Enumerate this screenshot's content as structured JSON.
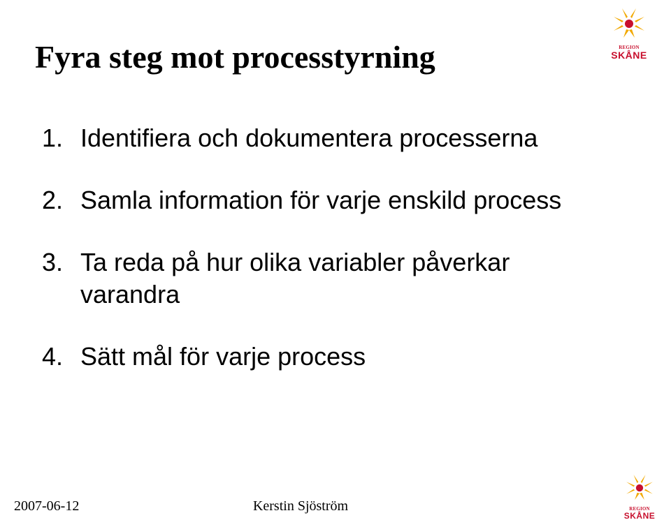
{
  "title": "Fyra steg mot processtyrning",
  "items": [
    {
      "num": "1.",
      "text": "Identifiera och dokumentera processerna"
    },
    {
      "num": "2.",
      "text": "Samla information för varje enskild process"
    },
    {
      "num": "3.",
      "text": "Ta reda på hur olika variabler påverkar varandra"
    },
    {
      "num": "4.",
      "text": "Sätt mål för varje process"
    }
  ],
  "footer": {
    "date": "2007-06-12",
    "author": "Kerstin Sjöström"
  },
  "logo": {
    "region": "REGION",
    "name": "SKÅNE"
  }
}
